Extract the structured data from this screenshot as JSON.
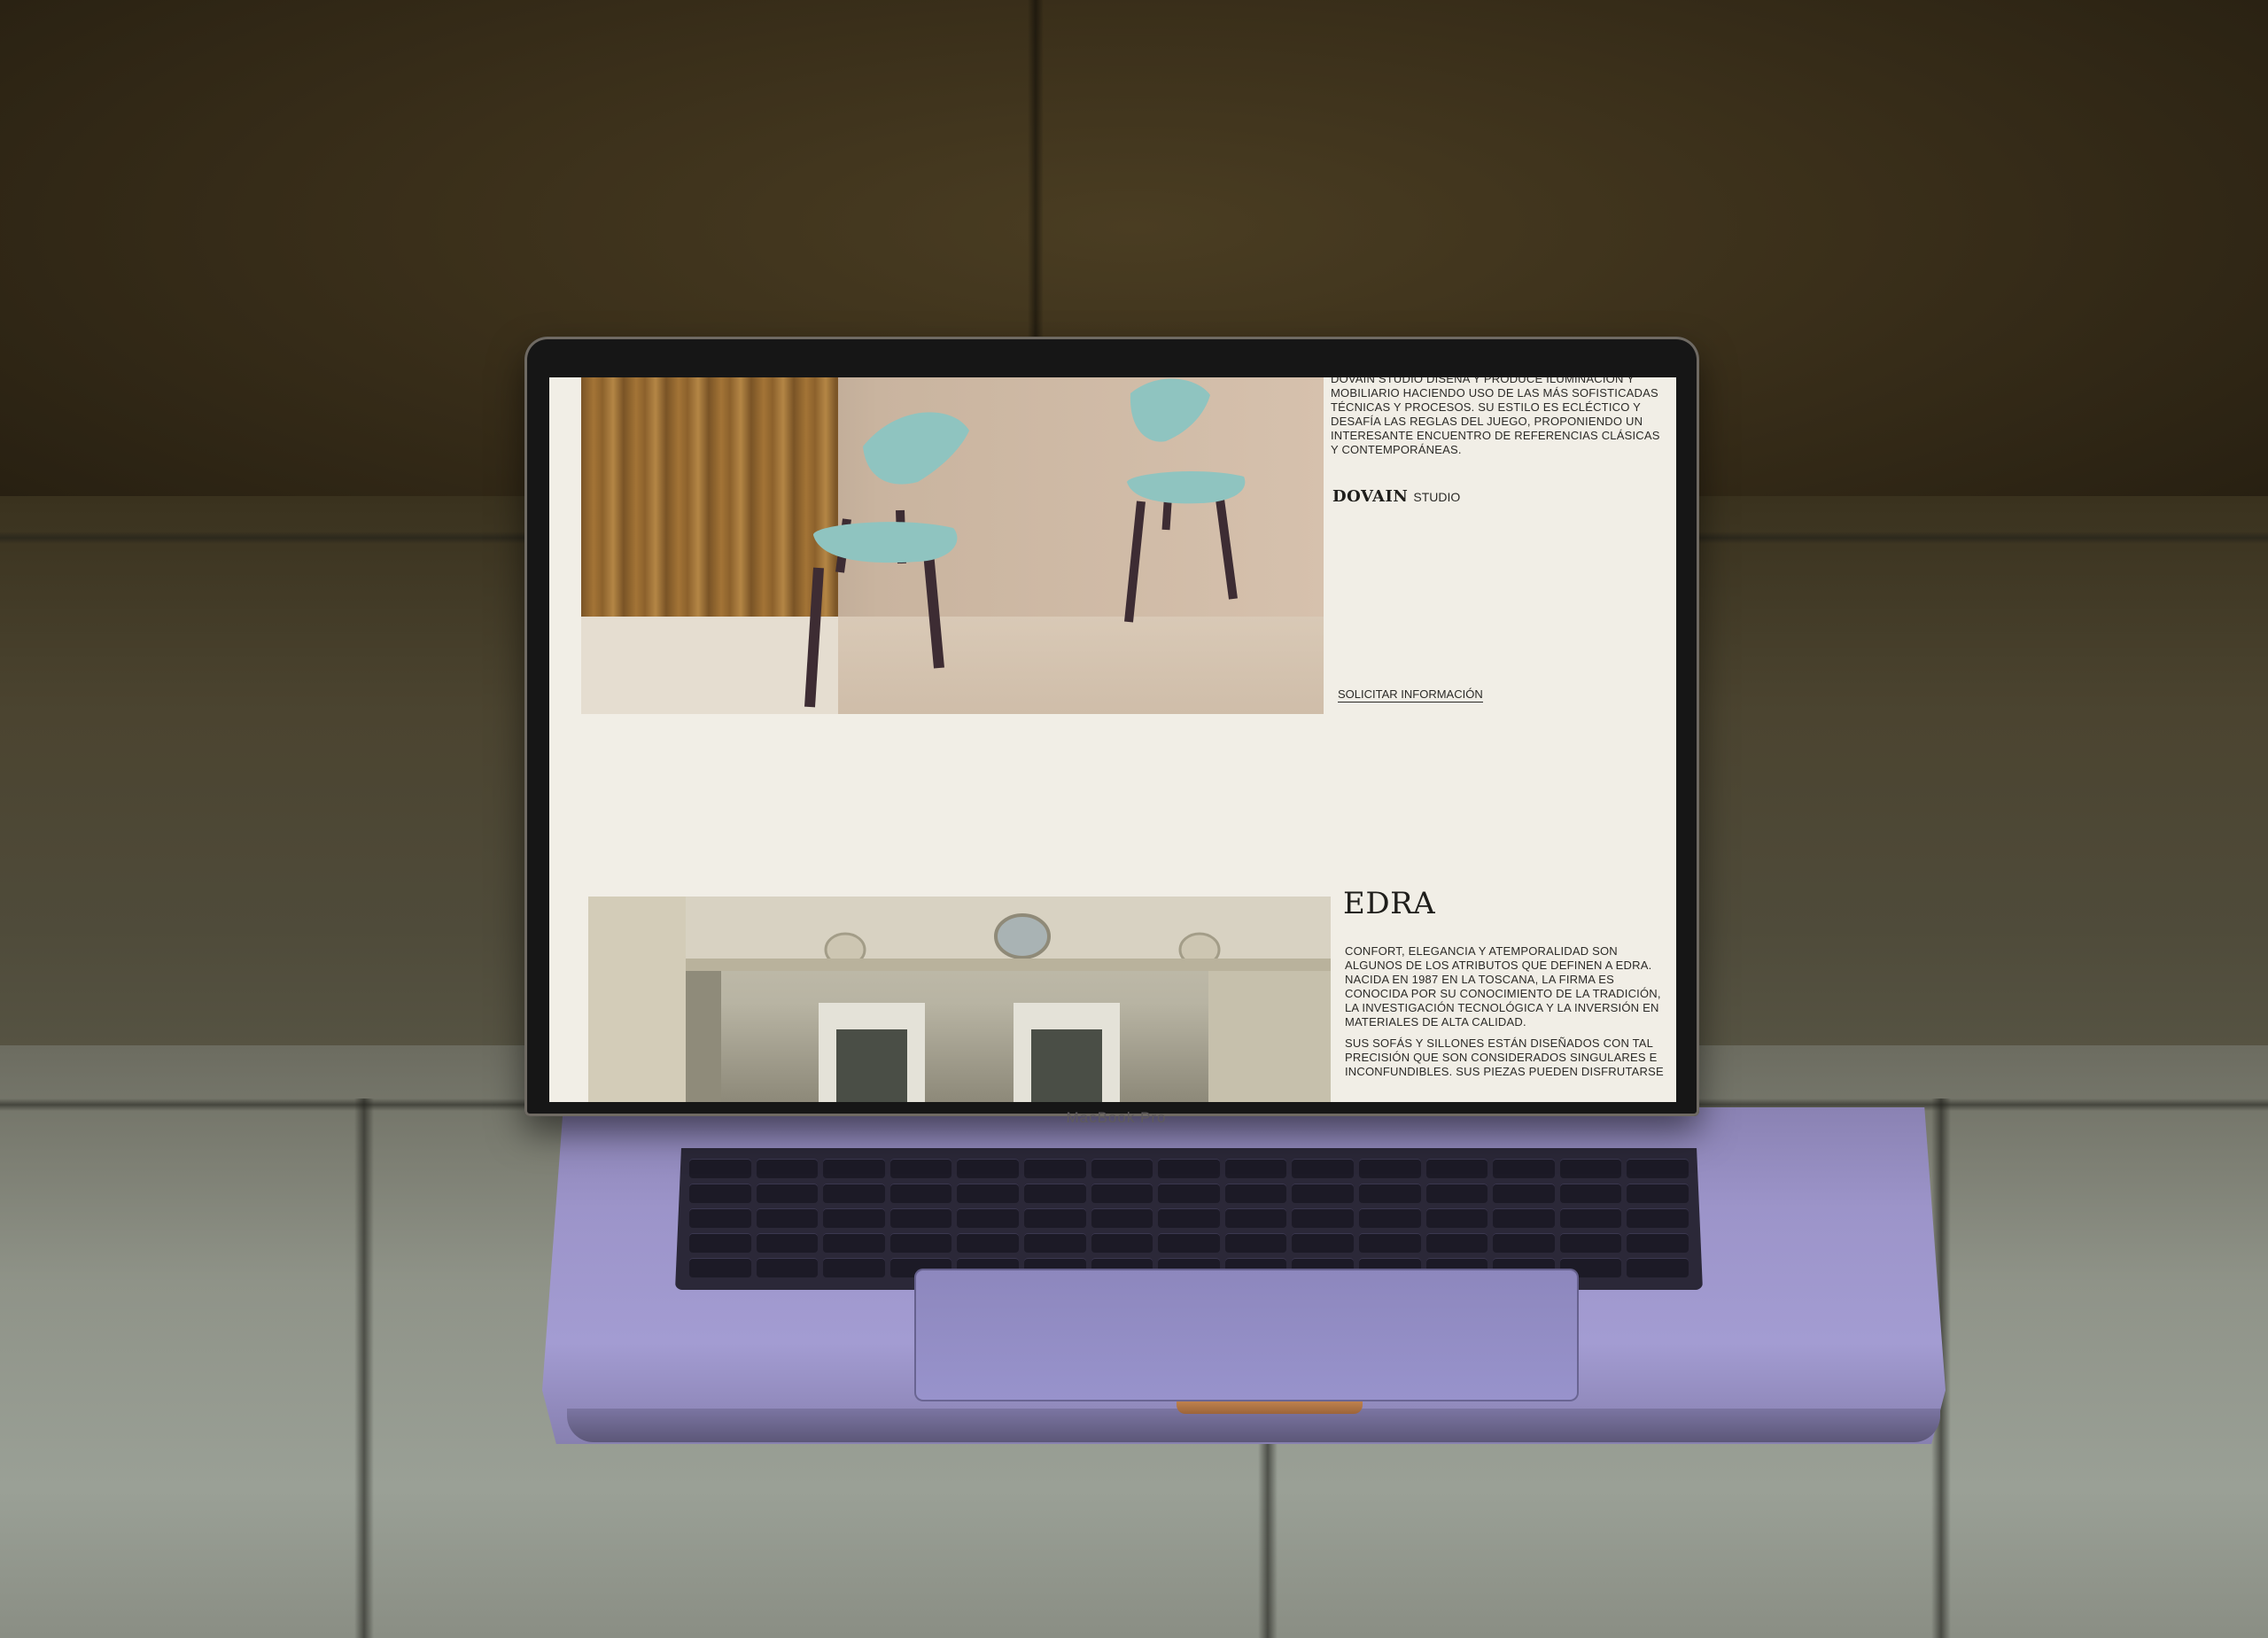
{
  "device": {
    "model_label": "MacBook Pro"
  },
  "page": {
    "dovain": {
      "intro": "DOVAIN STUDIO DISEÑA Y PRODUCE ILUMINACIÓN Y MOBILIARIO HACIENDO USO DE LAS MÁS SOFISTICADAS TÉCNICAS Y PROCESOS. SU ESTILO ES ECLÉCTICO Y DESAFÍA LAS REGLAS DEL JUEGO, PROPONIENDO UN INTERESANTE ENCUENTRO DE REFERENCIAS CLÁSICAS Y CONTEMPORÁNEAS.",
      "logo": "DOVAIN",
      "logo_sub": "STUDIO",
      "cta": "SOLICITAR INFORMACIÓN"
    },
    "edra": {
      "title": "EDRA",
      "paragraph_1": "CONFORT, ELEGANCIA Y ATEMPORALIDAD SON ALGUNOS DE LOS ATRIBUTOS QUE DEFINEN A EDRA. NACIDA EN 1987 EN LA TOSCANA, LA FIRMA ES CONOCIDA POR SU CONOCIMIENTO DE LA TRADICIÓN, LA INVESTIGACIÓN TECNOLÓGICA Y LA INVERSIÓN EN MATERIALES DE ALTA CALIDAD.",
      "paragraph_2": "SUS SOFÁS Y SILLONES ESTÁN DISEÑADOS CON TAL PRECISIÓN QUE SON CONSIDERADOS SINGULARES E INCONFUNDIBLES. SUS PIEZAS PUEDEN DISFRUTARSE"
    },
    "colors": {
      "page_background": "#f1eee6",
      "chair_upholstery": "#8fc4c0",
      "chair_legs": "#3d2c33"
    }
  }
}
